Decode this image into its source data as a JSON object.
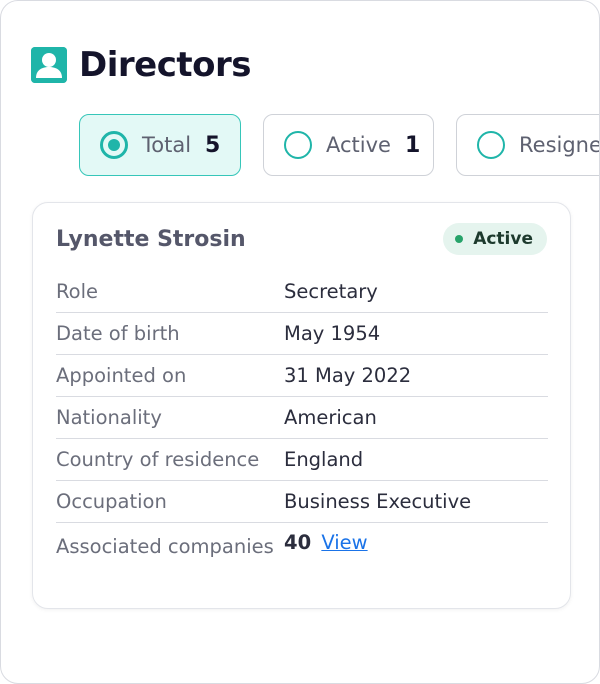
{
  "header": {
    "title": "Directors",
    "icon": "person-badge-icon"
  },
  "filters": [
    {
      "label": "Total",
      "count": "5",
      "selected": true
    },
    {
      "label": "Active",
      "count": "1",
      "selected": false
    },
    {
      "label": "Resigned",
      "count": "",
      "selected": false
    }
  ],
  "director": {
    "name": "Lynette Strosin",
    "status": "Active",
    "fields": [
      {
        "key": "Role",
        "value": "Secretary"
      },
      {
        "key": "Date of birth",
        "value": "May 1954"
      },
      {
        "key": "Appointed on",
        "value": "31 May 2022"
      },
      {
        "key": "Nationality",
        "value": "American"
      },
      {
        "key": "Country of residence",
        "value": "England"
      },
      {
        "key": "Occupation",
        "value": "Business Executive"
      }
    ],
    "associated": {
      "key": "Associated companies",
      "count": "40",
      "link_label": "View"
    }
  },
  "colors": {
    "accent": "#1fb5a9",
    "status_green": "#27a36a",
    "link": "#1a73e8"
  }
}
